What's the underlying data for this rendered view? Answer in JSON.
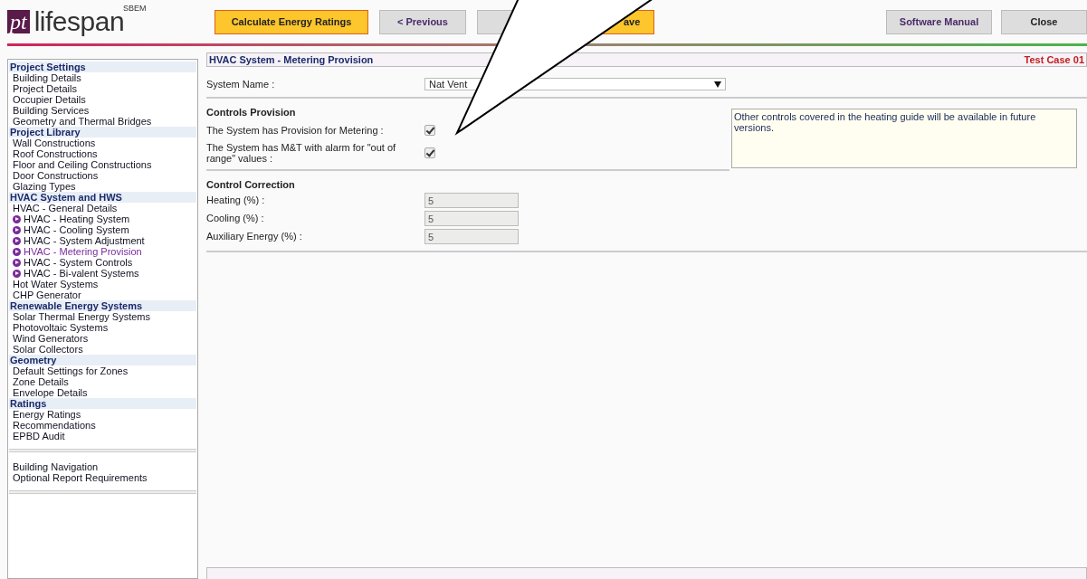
{
  "header": {
    "logo_mark": "pt",
    "logo_text": "lifespan",
    "logo_super": "SBEM",
    "buttons": [
      {
        "label": "Calculate Energy Ratings",
        "kind": "primary"
      },
      {
        "label": "< Previous",
        "kind": "nav"
      },
      {
        "kind": "plain"
      },
      {
        "label": "ave",
        "kind": "primary"
      }
    ],
    "right_buttons": [
      {
        "label": "Software Manual",
        "kind": "nav"
      },
      {
        "label": "Close",
        "kind": "plain"
      }
    ]
  },
  "sidebar": {
    "sections": [
      {
        "heading": "Project Settings",
        "items": [
          {
            "label": "Building Details",
            "kind": "link",
            "selected": false
          },
          {
            "label": "Project Details",
            "kind": "link",
            "selected": false
          },
          {
            "label": "Occupier Details",
            "kind": "link",
            "selected": false
          },
          {
            "label": "Building Services",
            "kind": "link",
            "selected": false
          },
          {
            "label": "Geometry and Thermal Bridges",
            "kind": "link",
            "selected": false
          }
        ]
      },
      {
        "heading": "Project Library",
        "items": [
          {
            "label": "Wall Constructions",
            "kind": "link",
            "selected": false
          },
          {
            "label": "Roof Constructions",
            "kind": "link",
            "selected": false
          },
          {
            "label": "Floor and Ceiling Constructions",
            "kind": "link",
            "selected": false
          },
          {
            "label": "Door Constructions",
            "kind": "link",
            "selected": false
          },
          {
            "label": "Glazing Types",
            "kind": "link",
            "selected": false
          }
        ]
      },
      {
        "heading": "HVAC System and HWS",
        "items": [
          {
            "label": "HVAC - General Details",
            "kind": "link",
            "selected": false
          },
          {
            "label": "HVAC - Heating System",
            "kind": "sub",
            "selected": false
          },
          {
            "label": "HVAC - Cooling System",
            "kind": "sub",
            "selected": false
          },
          {
            "label": "HVAC - System Adjustment",
            "kind": "sub",
            "selected": false
          },
          {
            "label": "HVAC - Metering Provision",
            "kind": "sub",
            "selected": true
          },
          {
            "label": "HVAC - System Controls",
            "kind": "sub",
            "selected": false
          },
          {
            "label": "HVAC - Bi-valent Systems",
            "kind": "sub",
            "selected": false
          },
          {
            "label": "Hot Water Systems",
            "kind": "link",
            "selected": false
          },
          {
            "label": "CHP Generator",
            "kind": "link",
            "selected": false
          }
        ]
      },
      {
        "heading": "Renewable Energy Systems",
        "items": [
          {
            "label": "Solar Thermal Energy Systems",
            "kind": "link",
            "selected": false
          },
          {
            "label": "Photovoltaic Systems",
            "kind": "link",
            "selected": false
          },
          {
            "label": "Wind Generators",
            "kind": "link",
            "selected": false
          },
          {
            "label": "Solar Collectors",
            "kind": "link",
            "selected": false
          }
        ]
      },
      {
        "heading": "Geometry",
        "items": [
          {
            "label": "Default Settings for Zones",
            "kind": "link",
            "selected": false
          },
          {
            "label": "Zone Details",
            "kind": "link",
            "selected": false
          },
          {
            "label": "Envelope Details",
            "kind": "link",
            "selected": false
          }
        ]
      },
      {
        "heading": "Ratings",
        "items": [
          {
            "label": "Energy Ratings",
            "kind": "link",
            "selected": false
          },
          {
            "label": "Recommendations",
            "kind": "link",
            "selected": false
          },
          {
            "label": "EPBD Audit",
            "kind": "link",
            "selected": false
          }
        ]
      }
    ],
    "extra_items": [
      {
        "label": "Building Navigation",
        "kind": "link",
        "selected": false
      },
      {
        "label": "Optional Report Requirements",
        "kind": "link",
        "selected": false
      }
    ]
  },
  "panel": {
    "title": "HVAC System - Metering Provision",
    "case": "Test Case 01",
    "system_name": {
      "label": "System Name :",
      "value": "Nat Vent"
    },
    "controls": {
      "heading": "Controls Provision",
      "checks": [
        {
          "label": "The System has Provision for Metering :",
          "checked": true
        },
        {
          "label": "The System has M&T with alarm for \"out of range\" values :",
          "checked": true
        }
      ],
      "note": "Other controls covered in the heating guide will be available in future versions."
    },
    "correction": {
      "heading": "Control Correction",
      "fields": [
        {
          "label": "Heating (%) :",
          "value": "5"
        },
        {
          "label": "Cooling (%) :",
          "value": "5"
        },
        {
          "label": "Auxiliary Energy (%) :",
          "value": "5"
        }
      ]
    }
  }
}
